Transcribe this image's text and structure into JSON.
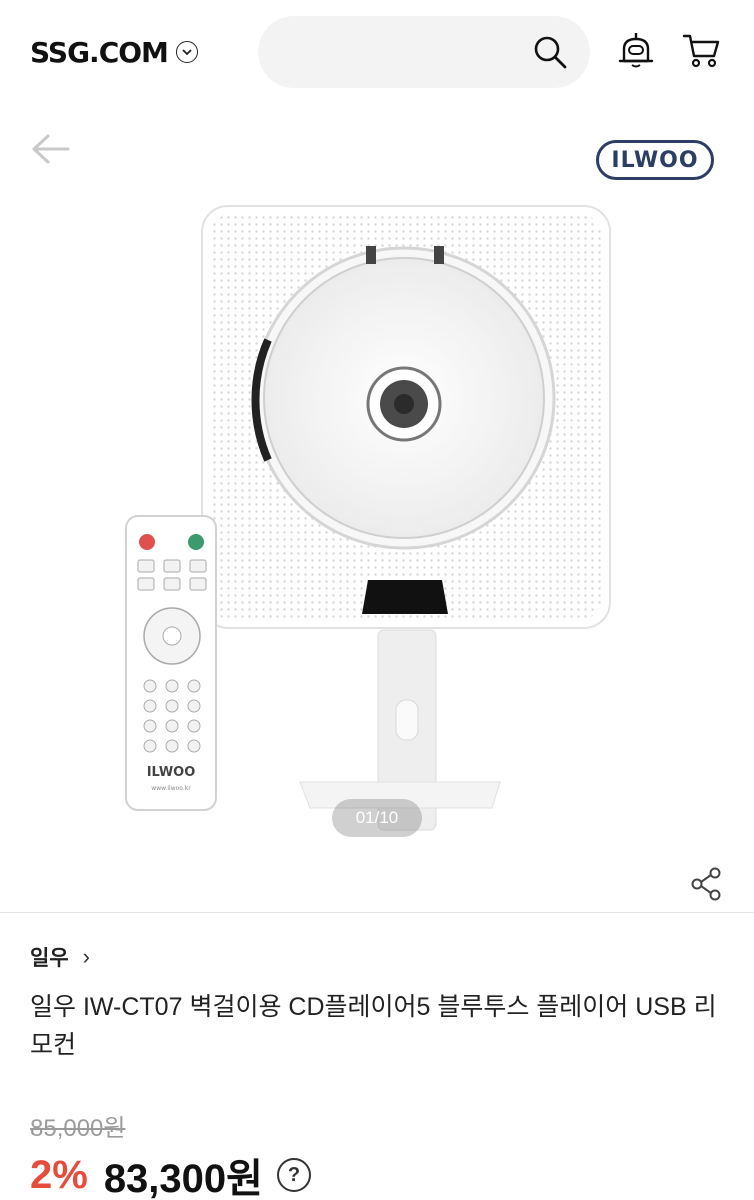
{
  "header": {
    "logo": "SSG.COM",
    "logo_dropdown_icon": "chevron-down-icon",
    "search": {
      "placeholder": "",
      "icon": "search-icon"
    },
    "notification_icon": "bell-robot-icon",
    "cart_icon": "cart-icon"
  },
  "gallery": {
    "back_icon": "arrow-left-icon",
    "brand_badge": "ILWOO",
    "counter": "01/10",
    "share_icon": "share-icon",
    "remote_brand": "ILWOO",
    "remote_url": "www.ilwoo.kr"
  },
  "product": {
    "brand": "일우",
    "brand_chevron": "›",
    "title": "일우 IW-CT07 벽걸이용 CD플레이어5 블루투스 플레이어 USB 리모컨",
    "original_price": "85,000원",
    "discount": "2%",
    "price": "83,300원",
    "help_icon": "?"
  },
  "colors": {
    "discount": "#e64c3c",
    "brand_badge": "#2c3e63",
    "search_bg": "#f3f3f3"
  }
}
